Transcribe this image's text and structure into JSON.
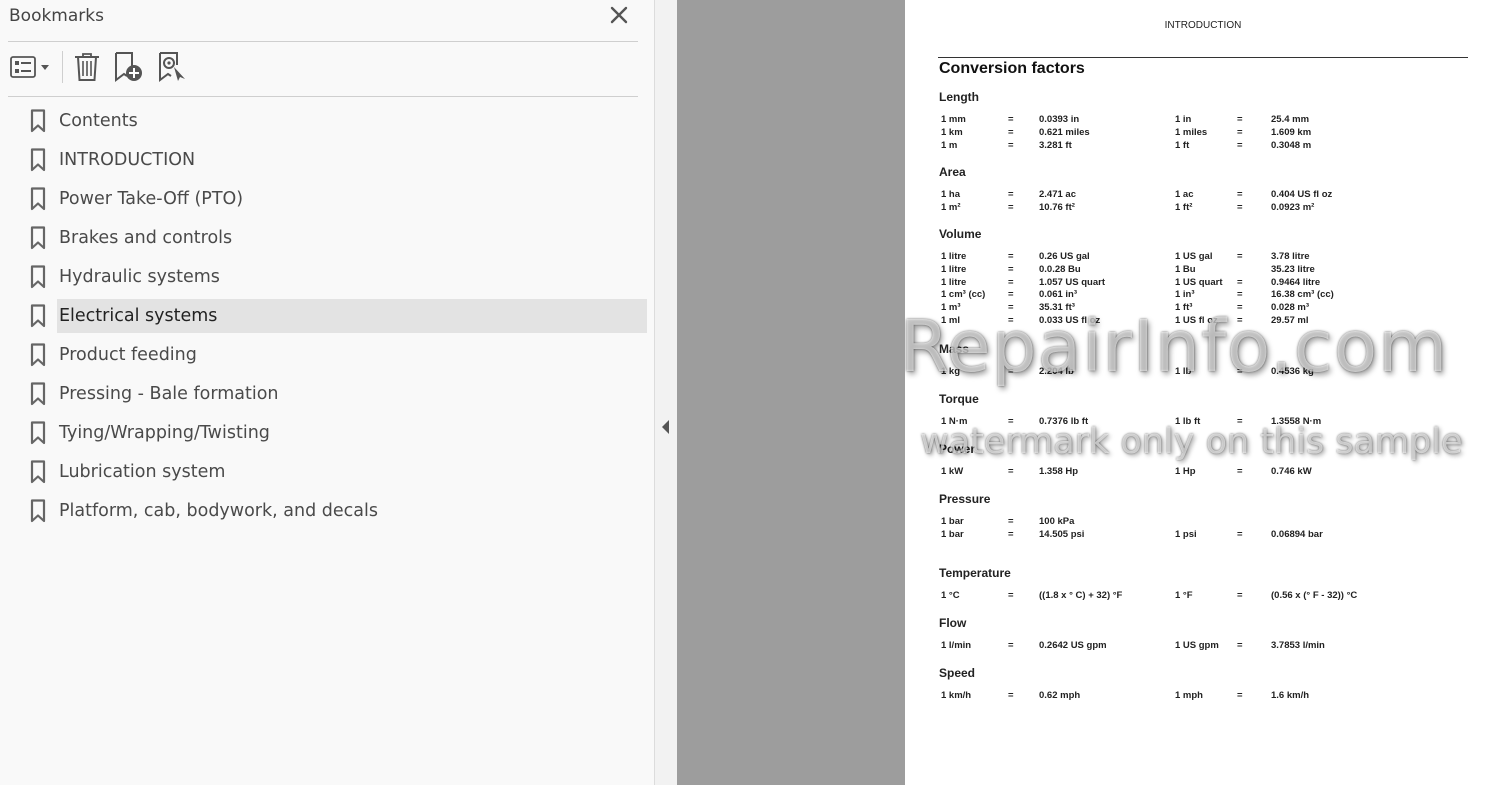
{
  "panel": {
    "title": "Bookmarks",
    "items": [
      {
        "label": "Contents"
      },
      {
        "label": "INTRODUCTION"
      },
      {
        "label": "Power Take-Off (PTO)"
      },
      {
        "label": "Brakes and controls"
      },
      {
        "label": "Hydraulic systems"
      },
      {
        "label": "Electrical systems",
        "selected": true
      },
      {
        "label": "Product feeding"
      },
      {
        "label": "Pressing - Bale formation"
      },
      {
        "label": "Tying/Wrapping/Twisting"
      },
      {
        "label": "Lubrication system"
      },
      {
        "label": "Platform, cab, bodywork, and decals"
      }
    ],
    "icons": {
      "options": "list-options-icon",
      "delete": "trash-icon",
      "new": "new-bookmark-icon",
      "find": "find-bookmark-icon",
      "close": "close-icon",
      "bookmark": "bookmark-ribbon-icon"
    }
  },
  "document": {
    "header": "INTRODUCTION",
    "title": "Conversion factors",
    "sections": [
      {
        "title": "Length",
        "rows": [
          [
            "1 mm",
            "=",
            "0.0393 in",
            "1 in",
            "=",
            "25.4 mm"
          ],
          [
            "1 km",
            "=",
            "0.621 miles",
            "1 miles",
            "=",
            "1.609 km"
          ],
          [
            "1 m",
            "=",
            "3.281 ft",
            "1 ft",
            "=",
            "0.3048 m"
          ]
        ]
      },
      {
        "title": "Area",
        "rows": [
          [
            "1 ha",
            "=",
            "2.471 ac",
            "1 ac",
            "=",
            "0.404 US fl oz"
          ],
          [
            "1 m²",
            "=",
            "10.76 ft²",
            "1 ft²",
            "=",
            "0.0923 m²"
          ]
        ]
      },
      {
        "title": "Volume",
        "rows": [
          [
            "1 litre",
            "=",
            "0.26 US gal",
            "1 US gal",
            "=",
            "3.78 litre"
          ],
          [
            "1 litre",
            "=",
            "0.0.28 Bu",
            "1 Bu",
            "",
            "35.23 litre"
          ],
          [
            "1 litre",
            "=",
            "1.057 US quart",
            "1 US quart",
            "=",
            "0.9464 litre"
          ],
          [
            "1 cm³ (cc)",
            "=",
            "0.061 in³",
            "1 in³",
            "=",
            "16.38 cm³ (cc)"
          ],
          [
            "1 m³",
            "=",
            "35.31 ft³",
            "1 ft³",
            "=",
            "0.028 m³"
          ],
          [
            "1 ml",
            "=",
            "0.033 US fl oz",
            "1 US fl oz",
            "=",
            "29.57 ml"
          ]
        ]
      },
      {
        "title": "Mass",
        "rows": [
          [
            "1 kg",
            "=",
            "2.204 lb",
            "1 lb",
            "=",
            "0.4536 kg"
          ]
        ]
      },
      {
        "title": "Torque",
        "rows": [
          [
            "1 N·m",
            "=",
            "0.7376 lb ft",
            "1 lb ft",
            "=",
            "1.3558 N·m"
          ]
        ]
      },
      {
        "title": "Power",
        "rows": [
          [
            "1 kW",
            "=",
            "1.358 Hp",
            "1 Hp",
            "=",
            "0.746 kW"
          ]
        ]
      },
      {
        "title": "Pressure",
        "rows": [
          [
            "1 bar",
            "=",
            "100 kPa",
            "",
            "",
            ""
          ],
          [
            "1 bar",
            "=",
            "14.505 psi",
            "1 psi",
            "=",
            "0.06894 bar"
          ]
        ]
      },
      {
        "title": "Temperature",
        "rows": [
          [
            "1 °C",
            "=",
            "((1.8 x ° C) + 32) °F",
            "1 °F",
            "=",
            "(0.56 x (° F - 32)) °C"
          ]
        ]
      },
      {
        "title": "Flow",
        "rows": [
          [
            "1 l/min",
            "=",
            "0.2642 US gpm",
            "1 US gpm",
            "=",
            "3.7853 l/min"
          ]
        ]
      },
      {
        "title": "Speed",
        "rows": [
          [
            "1 km/h",
            "=",
            "0.62 mph",
            "1 mph",
            "=",
            "1.6 km/h"
          ]
        ]
      }
    ],
    "watermark_line1": "eRepairInfo.com",
    "watermark_line2": "watermark only on this sample"
  }
}
